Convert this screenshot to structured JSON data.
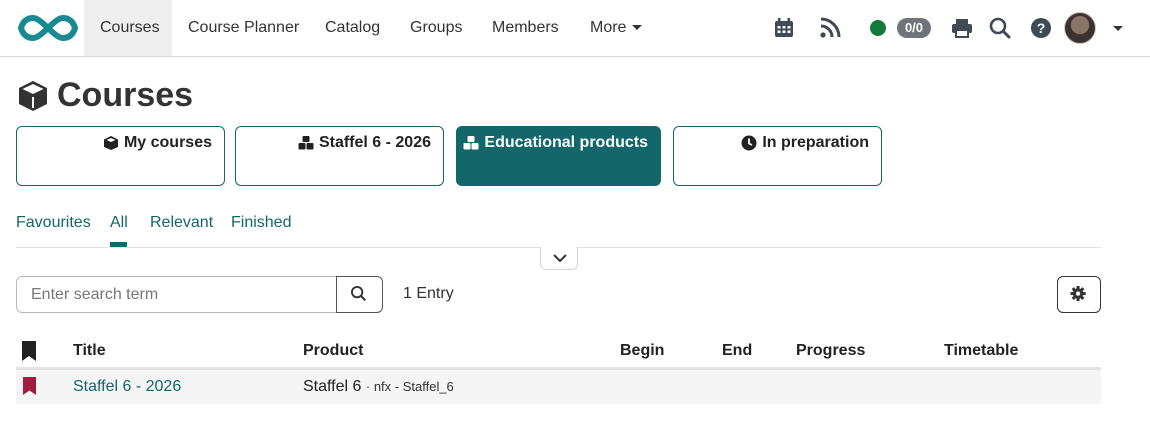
{
  "nav": {
    "items": [
      {
        "label": "Courses",
        "active": true
      },
      {
        "label": "Course Planner"
      },
      {
        "label": "Catalog"
      },
      {
        "label": "Groups"
      },
      {
        "label": "Members"
      },
      {
        "label": "More"
      }
    ],
    "badge": "0/0",
    "icons": [
      "calendar-icon",
      "rss-icon",
      "printer-icon",
      "search-icon",
      "help-icon"
    ]
  },
  "page": {
    "title": "Courses"
  },
  "segments": [
    {
      "label": "My courses",
      "icon": "cube-icon",
      "active": false
    },
    {
      "label": "Staffel 6 - 2026",
      "icon": "cubes-icon",
      "active": false
    },
    {
      "label": "Educational products",
      "icon": "cubes-icon",
      "active": true
    },
    {
      "label": "In preparation",
      "icon": "clock-icon",
      "active": false
    }
  ],
  "tabs": [
    {
      "label": "Favourites"
    },
    {
      "label": "All",
      "active": true
    },
    {
      "label": "Relevant"
    },
    {
      "label": "Finished"
    }
  ],
  "search": {
    "placeholder": "Enter search term",
    "value": ""
  },
  "entry_count": "1 Entry",
  "table": {
    "headers": [
      "Title",
      "Product",
      "Begin",
      "End",
      "Progress",
      "Timetable"
    ],
    "rows": [
      {
        "title": "Staffel 6 - 2026",
        "product": "Staffel 6",
        "product_meta": "· nfx - Staffel_6",
        "begin": "",
        "end": "",
        "progress": "",
        "timetable": ""
      }
    ]
  },
  "colors": {
    "accent": "#13676b",
    "bookmark": "#a11d3c",
    "status": "#147a3c"
  }
}
